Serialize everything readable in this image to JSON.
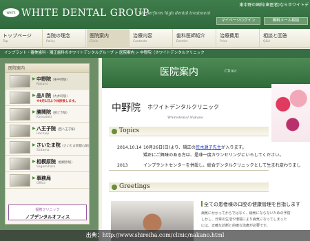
{
  "header": {
    "logo_text": "WHITE DENTAL GROUP",
    "brand": "WHITE DENTAL GROUP",
    "tagline": "We perform high dental treatment",
    "top_text": "東中野の歯科(歯医者)ならホワイトデ",
    "login_button": "マイページログイン",
    "mail_button": "無料メール相談"
  },
  "nav": {
    "items": [
      {
        "jp": "トップページ",
        "en": "Top"
      },
      {
        "jp": "当院の理念",
        "en": "Policy"
      },
      {
        "jp": "医院案内",
        "en": "Clinic"
      },
      {
        "jp": "治療内容",
        "en": "Contents"
      },
      {
        "jp": "歯科医師紹介",
        "en": "Dentist"
      },
      {
        "jp": "治療費用",
        "en": "Price"
      },
      {
        "jp": "相談と回答",
        "en": "Q&A"
      }
    ]
  },
  "breadcrumb": "インプラント・審美歯科・矯正歯科のホワイトデンタルグループ > 医院案内 > 中野院（ホワイトデンタルクリニック",
  "sidebar": {
    "heading": "医院案内",
    "clinics": [
      {
        "name": "中野院",
        "area": "(東中野駅)",
        "roma": "Nakano",
        "note": ""
      },
      {
        "name": "品川院",
        "area": "(大井町駅)",
        "roma": "",
        "note": "※9月1日より休診致します。"
      },
      {
        "name": "勝鬨院",
        "area": "(勝どき駅)",
        "roma": "Katsudoki",
        "note": ""
      },
      {
        "name": "八王子院",
        "area": "(西八王子駅)",
        "roma": "Hachioji",
        "note": ""
      },
      {
        "name": "さいたま院",
        "area": "(さいたま新都心駅)",
        "roma": "Saitama",
        "note": ""
      },
      {
        "name": "相模原院",
        "area": "(相模原駅)",
        "roma": "Sagamihara",
        "note": ""
      },
      {
        "name": "事務局",
        "area": "",
        "roma": "Office",
        "note": ""
      }
    ],
    "nohe_small": "提携クリニック",
    "nohe_name": "ノブデンタルオフィス"
  },
  "main": {
    "banner_title": "医院案内",
    "banner_sub": "Clinic",
    "clinic_name": "中野院",
    "clinic_name_sub": "ホワイトデンタルクリニック",
    "clinic_roma": "Whitedental Nakano",
    "topics_title": "Topics",
    "topics": [
      {
        "date": "2014.10.14",
        "before": "10月26日(日)より、矯正の",
        "link": "荒木瀬子先生",
        "after": "が入ります。"
      },
      {
        "date": "",
        "before": "矯正にご興味のある方は、是非一度カウンセリングにいらしてください。",
        "link": "",
        "after": ""
      },
      {
        "date": "2013",
        "before": "インプラントセンターを併設し、総合デンタルクリニックとして生まれ変わりまし",
        "link": "",
        "after": ""
      }
    ],
    "greetings_title": "Greetings",
    "greeting_lead": "全ての患者様の口腔の健康管理を目指します",
    "greeting_body": [
      "病気にかかってからではなく、病気にならないための予防",
      "しかし、日常の生活や環境により病気になってしまった",
      "には、正確な診断と的確な治療が必要です。"
    ]
  },
  "source": "出典：http://www.shireiha.com/clinic/nakano.html"
}
